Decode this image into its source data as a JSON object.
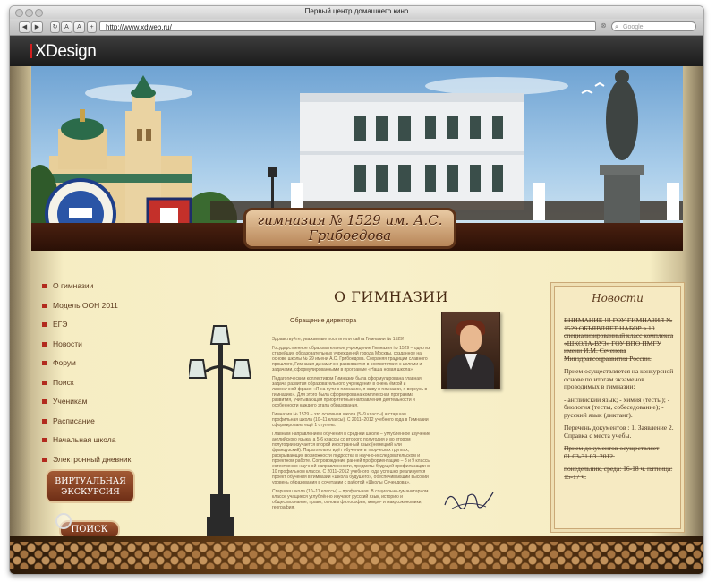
{
  "browser": {
    "window_title": "Первый центр домашнего кино",
    "url": "http://www.xdweb.ru/",
    "search_placeholder": "Google"
  },
  "brand": {
    "logo": "XDesign"
  },
  "site": {
    "header_banner": "гимназия № 1529 им. А.С. Грибоедова",
    "emblem_text": "«Образование»",
    "nav": [
      "О гимназии",
      "Модель ООН 2011",
      "ЕГЭ",
      "Новости",
      "Форум",
      "Поиск",
      "Ученикам",
      "Расписание",
      "Начальная школа",
      "Электронный дневник"
    ],
    "virtual_tour_button": "ВИРТУАЛЬНАЯ ЭКСКУРСИЯ",
    "search_button": "ПОИСК",
    "main": {
      "title": "О ГИМНАЗИИ",
      "subhead": "Обращение директора",
      "paragraphs": [
        "Здравствуйте, уважаемые посетители сайта Гимназии № 1529!",
        "Государственное образовательное учреждение Гимназия № 1529 – одно из старейших образовательных учреждений города Москвы, созданное на основе школы № 29 имени А.С. Грибоедова. Сохраняя традиции славного прошлого, Гимназия динамично развивается в соответствии с целями и задачами, сформулированными в программе «Наша новая школа».",
        "Педагогическим коллективом Гимназии была сформулирована главная задача развития образовательного учреждения в очень ёмкой и лаконичной фразе: «Я на пути в гимназию, я живу в гимназии, я вернусь в гимназию». Для этого была сформирована комплексная программа развития, учитывающая приоритетные направления деятельности и особенности каждого этапа образования.",
        "Гимназия № 1529 – это основная школа (5–9 классы) и старшая профильная школа (10–11 классы). С 2011–2012 учебного года в Гимназии сформирована ещё 1 ступень.",
        "Главным направлением обучения в средней школе – углубленное изучение английского языка, а 5-6 классы со второго полугодия и во втором полугодии изучается второй иностранный язык (немецкий или французский). Параллельно идёт обучение в творческих группах, раскрывающих возможности подростка в научно-исследовательском и проектном работе. Сопровождение ранней профориентацию – 8 и 9 классы естественно-научной направленности, предметы будущей профилизации в 10 профильном классе. С 2011–2012 учебного года успешно реализуется проект обучения в гимназии «Школа будущего», обеспечивающий высокий уровень образования в сочетании с работой «Школы Сечеедова».",
        "Старшая школа (10–11 классы) – профильная. В социально-гуманитарном классе учащиеся углублённо изучают русский язык, историю и обществознание, право, основы философии, микро- и макроэкономики, география."
      ]
    },
    "news": {
      "title": "Новости",
      "items": [
        "ВНИМАНИЕ !!! ГОУ ГИМНАЗИЯ № 1529 ОБЪЯВЛЯЕТ НАБОР в 10 специализированный класс комплекса «ШКОЛА-ВУЗ» ГОУ ВПО ПМГУ имени И.М. Сеченова Минздравсоцразвития России.",
        "Прием осуществляется на конкурсной основе по итогам экзаменов проводимых в гимназии:",
        "- английский язык; - химия (тесты); - биология (тесты, собеседование); - русский язык (диктант).",
        "Перечень документов : 1. Заявление 2. Справка с места учебы.",
        "Прием документов осуществляет 01.03-31.03. 2012.",
        "понедельник, среда: 16-18 ч. пятница: 15-17 ч."
      ]
    }
  }
}
